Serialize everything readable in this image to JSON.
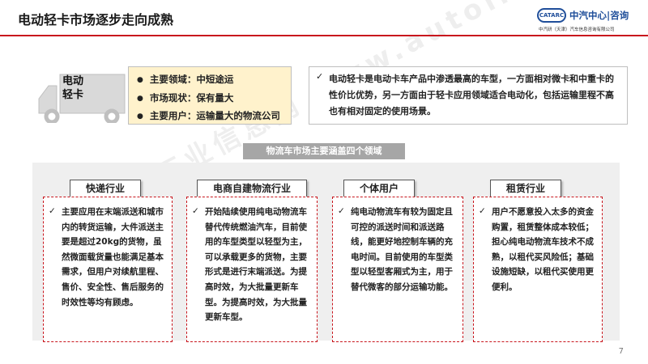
{
  "title": "电动轻卡市场逐步走向成熟",
  "logo": {
    "mark": "CATARC",
    "name": "中汽中心|咨询",
    "sub": "中汽研（天津）汽车信息咨询有限公司"
  },
  "truck_label": "电动\n轻卡",
  "highlights": [
    "主要领域：中短途运",
    "市场现状：保有量大",
    "主要用户：运输量大的物流公司"
  ],
  "summary": "电动轻卡是电动卡车产品中渗透最高的车型，一方面相对微卡和中重卡的性价比优势，另一方面由于轻卡应用领域适合电动化，包括运输里程不高也有相对固定的使用场景。",
  "banner": "物流车市场主要涵盖四个领域",
  "segments": [
    {
      "name": "快递行业",
      "text": "主要应用在末端派送和城市内的转货运输，大件派送主要是超过20kg的货物，虽然微面载货量也能满足基本需求，但用户对续航里程、售价、安全性、售后服务的时效性等均有顾虑。"
    },
    {
      "name": "电商自建物流行业",
      "text": "开始陆续使用纯电动物流车替代传统燃油汽车，目前使用的车型类型以轻型为主，可以承载更多的货物，主要形式是进行末端派送。为提高时效，为大批量更新车型。为提高时效，为大批量更新车型。"
    },
    {
      "name": "个体用户",
      "text": "纯电动物流车有较为固定且可控的派送时间和派送路线，能更好地控制车辆的充电时间。目前使用的车型类型以轻型客厢式为主，用于替代微客的部分运输功能。"
    },
    {
      "name": "租赁行业",
      "text": "用户不愿意投入太多的资金购置，租赁整体成本较低；担心纯电动物流车技术不成熟，以租代买风险低；基础设施短缺，以租代买使用更便利。"
    }
  ],
  "watermark": "中国汽车工业信息网 www.autoinfo.org.cn",
  "page_number": "7",
  "colors": {
    "accent": "#c8161d",
    "brand": "#1f4e9a",
    "highlight_bg": "#fff2cc",
    "banner_bg": "#a6a6a6"
  }
}
